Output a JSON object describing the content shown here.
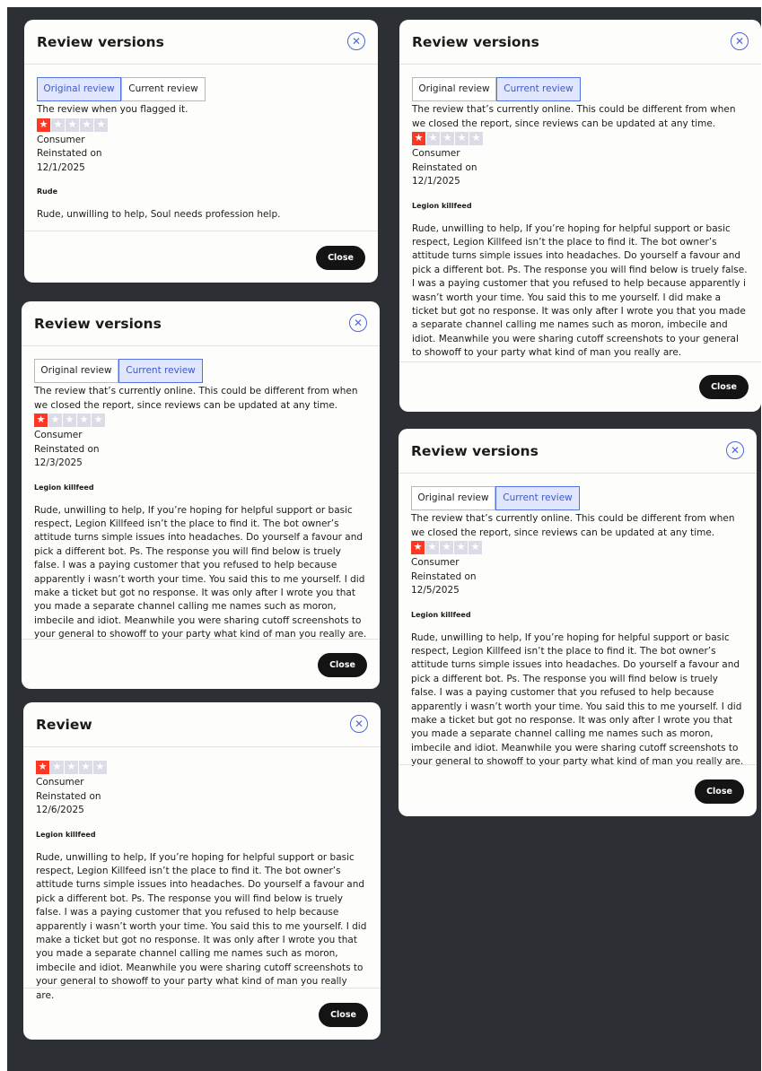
{
  "modals": [
    {
      "title": "Review versions",
      "tabs": [
        "Original review",
        "Current review"
      ],
      "active_tab": 0,
      "description": "The review when you flagged it.",
      "rating": 1,
      "consumer": "Consumer",
      "reinstated": "Reinstated on",
      "date": "12/1/2025",
      "review_title": "Rude",
      "review_body": "Rude, unwilling to help, Soul needs profession help.",
      "close": "Close"
    },
    {
      "title": "Review versions",
      "tabs": [
        "Original review",
        "Current review"
      ],
      "active_tab": 1,
      "description": "The review that’s currently online. This could be different from when we closed the report, since reviews can be updated at any time.",
      "rating": 1,
      "consumer": "Consumer",
      "reinstated": "Reinstated on",
      "date": "12/1/2025",
      "review_title": "Legion killfeed",
      "review_body": "Rude, unwilling to help, If you’re hoping for helpful support or basic respect, Legion Killfeed isn’t the place to find it. The bot owner’s attitude turns simple issues into headaches. Do yourself a favour and pick a different bot. Ps. The response you will find below is truely false. I was a paying customer that you refused to help because apparently i wasn’t worth your time. You said this to me yourself. I did make a ticket but got no response. It was only after I wrote you that you made a separate channel calling me names such as moron, imbecile and idiot. Meanwhile you were sharing cutoff screenshots to your general to showoff to your party what kind of man you really are.",
      "close": "Close"
    },
    {
      "title": "Review versions",
      "tabs": [
        "Original review",
        "Current review"
      ],
      "active_tab": 1,
      "description": "The review that’s currently online. This could be different from when we closed the report, since reviews can be updated at any time.",
      "rating": 1,
      "consumer": "Consumer",
      "reinstated": "Reinstated on",
      "date": "12/3/2025",
      "review_title": "Legion killfeed",
      "review_body": "Rude, unwilling to help, If you’re hoping for helpful support or basic respect, Legion Killfeed isn’t the place to find it. The bot owner’s attitude turns simple issues into headaches. Do yourself a favour and pick a different bot. Ps. The response you will find below is truely false. I was a paying customer that you refused to help because apparently i wasn’t worth your time. You said this to me yourself. I did make a ticket but got no response. It was only after I wrote you that you made a separate channel calling me names such as moron, imbecile and idiot. Meanwhile you were sharing cutoff screenshots to your general to showoff to your party what kind of man you really are.",
      "close": "Close"
    },
    {
      "title": "Review versions",
      "tabs": [
        "Original review",
        "Current review"
      ],
      "active_tab": 1,
      "description": "The review that’s currently online. This could be different from when we closed the report, since reviews can be updated at any time.",
      "rating": 1,
      "consumer": "Consumer",
      "reinstated": "Reinstated on",
      "date": "12/5/2025",
      "review_title": "Legion killfeed",
      "review_body": "Rude, unwilling to help, If you’re hoping for helpful support or basic respect, Legion Killfeed isn’t the place to find it. The bot owner’s attitude turns simple issues into headaches. Do yourself a favour and pick a different bot. Ps. The response you will find below is truely false. I was a paying customer that you refused to help because apparently i wasn’t worth your time. You said this to me yourself. I did make a ticket but got no response. It was only after I wrote you that you made a separate channel calling me names such as moron, imbecile and idiot. Meanwhile you were sharing cutoff screenshots to your general to showoff to your party what kind of man you really are.",
      "close": "Close"
    },
    {
      "title": "Review",
      "tabs": [],
      "active_tab": null,
      "description": "",
      "rating": 1,
      "consumer": "Consumer",
      "reinstated": "Reinstated on",
      "date": "12/6/2025",
      "review_title": "Legion killfeed",
      "review_body": "Rude, unwilling to help, If you’re hoping for helpful support or basic respect, Legion Killfeed isn’t the place to find it. The bot owner’s attitude turns simple issues into headaches. Do yourself a favour and pick a different bot. Ps. The response you will find below is truely false. I was a paying customer that you refused to help because apparently i wasn’t worth your time. You said this to me yourself. I did make a ticket but got no response. It was only after I wrote you that you made a separate channel calling me names such as moron, imbecile and idiot. Meanwhile you were sharing cutoff screenshots to your general to showoff to your party what kind of man you really are.",
      "close": "Close"
    }
  ],
  "colors": {
    "backdrop": "#2c2f33",
    "accent": "#4f66d8",
    "star_on": "#ff3722",
    "star_off": "#dcdce6"
  }
}
